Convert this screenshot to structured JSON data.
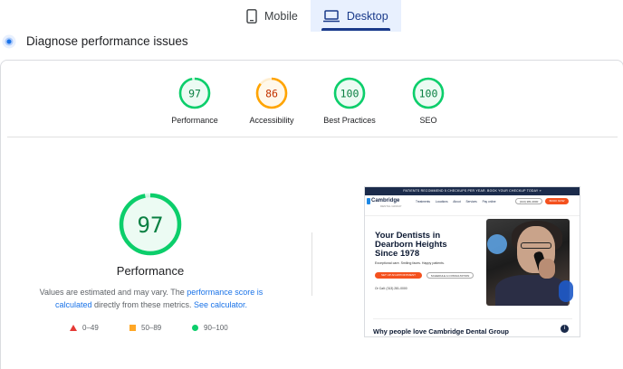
{
  "tabs": {
    "mobile": "Mobile",
    "desktop": "Desktop",
    "active": "desktop"
  },
  "header": {
    "title": "Diagnose performance issues"
  },
  "categories": [
    {
      "label": "Performance",
      "score": 97,
      "color": "#0cce6b",
      "text_color": "#0b8043"
    },
    {
      "label": "Accessibility",
      "score": 86,
      "color": "#ffa400",
      "text_color": "#c33300"
    },
    {
      "label": "Best Practices",
      "score": 100,
      "color": "#0cce6b",
      "text_color": "#0b8043"
    },
    {
      "label": "SEO",
      "score": 100,
      "color": "#0cce6b",
      "text_color": "#0b8043"
    }
  ],
  "main": {
    "score": 97,
    "label": "Performance",
    "note_prefix": "Values are estimated and may vary. The ",
    "note_link1": "performance score is calculated",
    "note_middle": " directly from these metrics. ",
    "note_link2": "See calculator.",
    "note_suffix": ""
  },
  "legend": [
    {
      "shape": "triangle",
      "range": "0–49",
      "color": "#e53935"
    },
    {
      "shape": "square",
      "range": "50–89",
      "color": "#ffa726"
    },
    {
      "shape": "circle",
      "range": "90–100",
      "color": "#0cce6b"
    }
  ],
  "screenshot": {
    "banner": "PATIENTS RECOMMEND 5 CHECKUPS PER YEAR. BOOK YOUR CHECKUP TODAY »",
    "brand": "Cambridge",
    "brand_sub": "DENTAL GROUP",
    "nav": [
      "Treatments",
      "Locations",
      "About",
      "Services",
      "Pay online"
    ],
    "phone": "(313) 281-0000",
    "book": "BOOK NOW",
    "headline": "Your Dentists in Dearborn Heights Since 1978",
    "tagline": "Exceptional care. Smiling faces. Happy patients.",
    "cta1": "SET UP AN APPOINTMENT",
    "cta2": "SCHEDULE A CONSULTATION",
    "call": "Or Call: (313) 281-0000",
    "why": "Why people love Cambridge Dental Group"
  }
}
